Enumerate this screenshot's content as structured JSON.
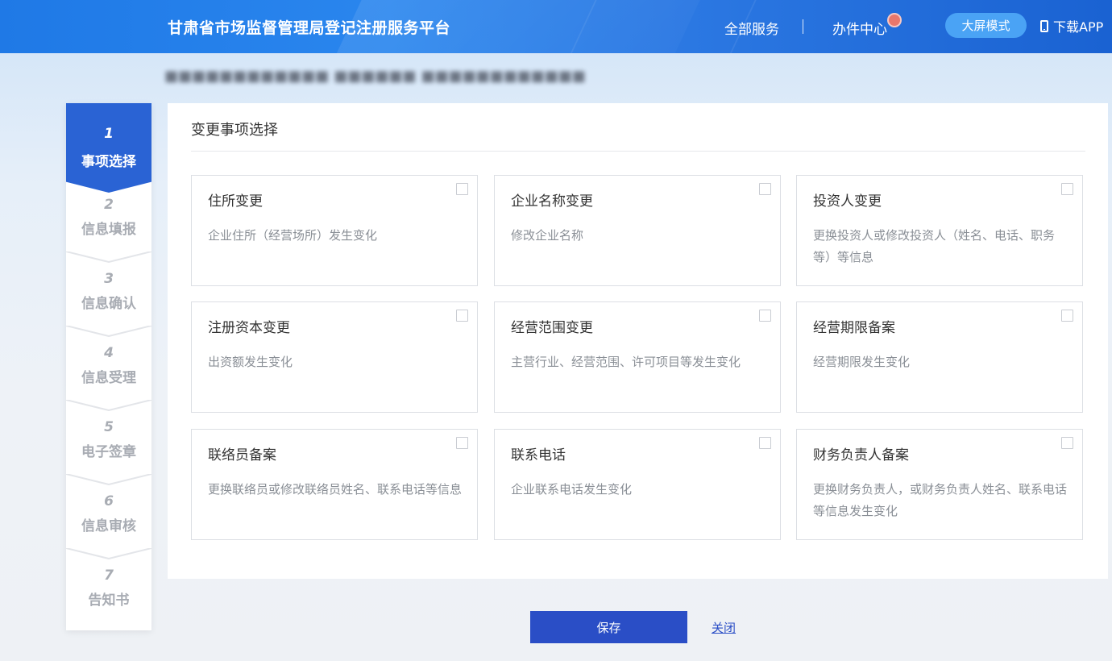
{
  "header": {
    "site_title": "甘肃省市场监督管理局登记注册服务平台",
    "nav_all_services": "全部服务",
    "nav_work_center": "办件中心",
    "big_screen_button": "大屏模式",
    "download_app": "下载APP",
    "icons": {
      "download": "phone-icon",
      "notification": "badge-dot"
    }
  },
  "company": {
    "name": "■■■■■■■■■■■■ ■■■■■■ ■■■■■■■■■■■■"
  },
  "steps": [
    {
      "num": "1",
      "label": "事项选择",
      "active": true
    },
    {
      "num": "2",
      "label": "信息填报",
      "active": false
    },
    {
      "num": "3",
      "label": "信息确认",
      "active": false
    },
    {
      "num": "4",
      "label": "信息受理",
      "active": false
    },
    {
      "num": "5",
      "label": "电子签章",
      "active": false
    },
    {
      "num": "6",
      "label": "信息审核",
      "active": false
    },
    {
      "num": "7",
      "label": "告知书",
      "active": false
    }
  ],
  "panel": {
    "title": "变更事项选择",
    "cards": [
      {
        "title": "住所变更",
        "desc": "企业住所（经营场所）发生变化",
        "checked": false
      },
      {
        "title": "企业名称变更",
        "desc": "修改企业名称",
        "checked": false
      },
      {
        "title": "投资人变更",
        "desc": "更换投资人或修改投资人（姓名、电话、职务等）等信息",
        "checked": false
      },
      {
        "title": "注册资本变更",
        "desc": "出资额发生变化",
        "checked": false
      },
      {
        "title": "经营范围变更",
        "desc": "主营行业、经营范围、许可项目等发生变化",
        "checked": false
      },
      {
        "title": "经营期限备案",
        "desc": "经营期限发生变化",
        "checked": false
      },
      {
        "title": "联络员备案",
        "desc": "更换联络员或修改联络员姓名、联系电话等信息",
        "checked": false
      },
      {
        "title": "联系电话",
        "desc": "企业联系电话发生变化",
        "checked": false
      },
      {
        "title": "财务负责人备案",
        "desc": "更换财务负责人，或财务负责人姓名、联系电话等信息发生变化",
        "checked": false
      }
    ]
  },
  "actions": {
    "save": "保存",
    "close": "关闭"
  },
  "colors": {
    "header_blue": "#2c79e3",
    "primary": "#2a63d4",
    "save_button": "#2a4ec6",
    "badge": "#e8776b",
    "pill_button": "#4aa3f5"
  }
}
